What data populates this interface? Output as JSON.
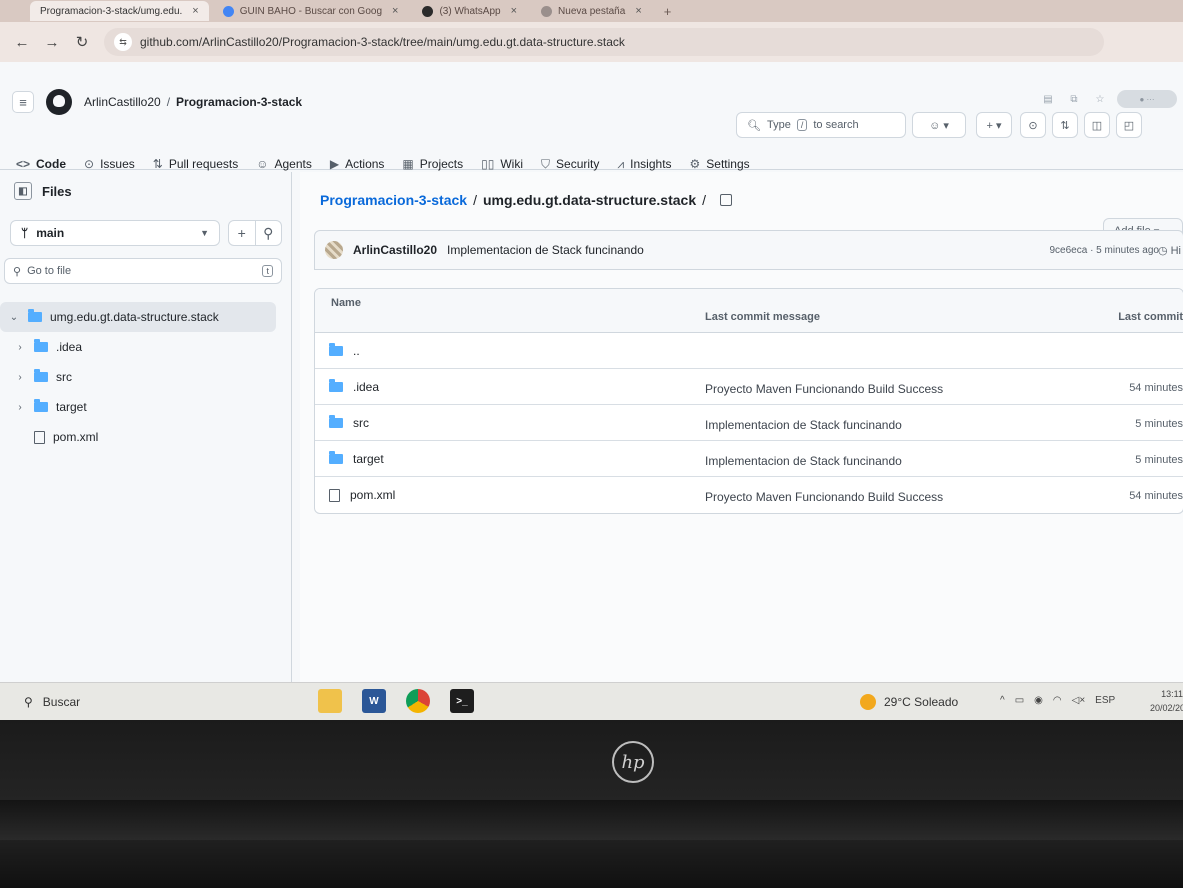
{
  "browser": {
    "tabs": [
      {
        "label": "Programacion-3-stack/umg.edu.",
        "active": true
      },
      {
        "label": "GUIN BAHO - Buscar con Goog",
        "active": false
      },
      {
        "label": "(3) WhatsApp",
        "active": false
      },
      {
        "label": "Nueva pestaña",
        "active": false
      }
    ],
    "url": "github.com/ArlinCastillo20/Programacion-3-stack/tree/main/umg.edu.gt.data-structure.stack"
  },
  "header": {
    "owner": "ArlinCastillo20",
    "separator": "/",
    "repo": "Programacion-3-stack",
    "search_prefix": "Type",
    "search_key": "/",
    "search_suffix": "to search"
  },
  "repo_nav": [
    {
      "label": "Code",
      "icon": "code-icon",
      "selected": true
    },
    {
      "label": "Issues",
      "icon": "issue-icon"
    },
    {
      "label": "Pull requests",
      "icon": "pull-request-icon"
    },
    {
      "label": "Agents",
      "icon": "agents-icon"
    },
    {
      "label": "Actions",
      "icon": "actions-icon"
    },
    {
      "label": "Projects",
      "icon": "projects-icon"
    },
    {
      "label": "Wiki",
      "icon": "wiki-icon"
    },
    {
      "label": "Security",
      "icon": "security-icon"
    },
    {
      "label": "Insights",
      "icon": "insights-icon"
    },
    {
      "label": "Settings",
      "icon": "settings-icon"
    }
  ],
  "sidebar": {
    "title": "Files",
    "branch": "main",
    "goto_placeholder": "Go to file",
    "goto_key": "t",
    "tree": [
      {
        "label": "umg.edu.gt.data-structure.stack",
        "type": "folder",
        "expanded": true
      },
      {
        "label": ".idea",
        "type": "folder"
      },
      {
        "label": "src",
        "type": "folder"
      },
      {
        "label": "target",
        "type": "folder"
      },
      {
        "label": "pom.xml",
        "type": "file"
      }
    ]
  },
  "main": {
    "crumb_repo": "Programacion-3-stack",
    "crumb_sep": "/",
    "crumb_folder": "umg.edu.gt.data-structure.stack",
    "crumb_trailing": "/",
    "add_file": "Add file",
    "commit": {
      "author": "ArlinCastillo20",
      "message": "Implementacion de Stack funcinando",
      "meta": "9ce6eca · 5 minutes ago"
    },
    "columns": {
      "name": "Name",
      "message": "Last commit message",
      "date": "Last commit"
    },
    "rows": [
      {
        "name": "..",
        "type": "folder",
        "message": "",
        "time": ""
      },
      {
        "name": ".idea",
        "type": "folder",
        "message": "Proyecto Maven Funcionando Build Success",
        "time": "54 minutes"
      },
      {
        "name": "src",
        "type": "folder",
        "message": "Implementacion de Stack funcinando",
        "time": "5 minutes"
      },
      {
        "name": "target",
        "type": "folder",
        "message": "Implementacion de Stack funcinando",
        "time": "5 minutes"
      },
      {
        "name": "pom.xml",
        "type": "file",
        "message": "Proyecto Maven Funcionando Build Success",
        "time": "54 minutes"
      }
    ]
  },
  "taskbar": {
    "search": "Buscar",
    "weather": "29°C Soleado",
    "lang": "ESP",
    "time": "13:11",
    "date": "20/02/20"
  },
  "device": {
    "brand": "hp"
  }
}
